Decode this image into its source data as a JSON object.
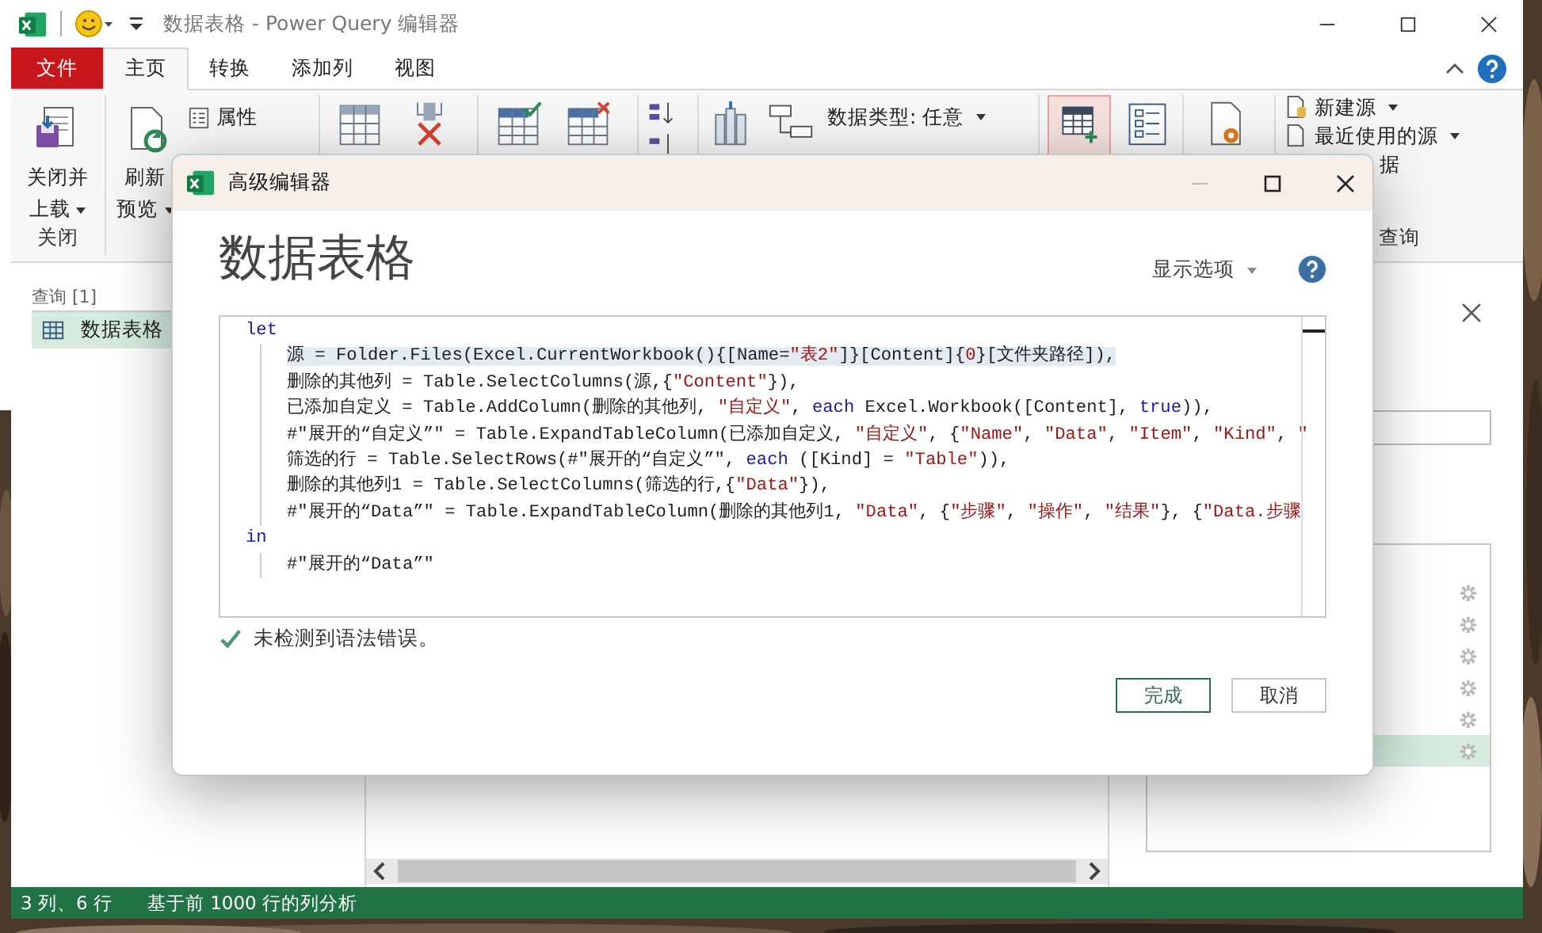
{
  "window": {
    "title": "数据表格 - Power Query 编辑器"
  },
  "ribbon_tabs": [
    {
      "label": "文件",
      "kind": "file",
      "selected": false
    },
    {
      "label": "主页",
      "kind": "tab",
      "selected": true
    },
    {
      "label": "转换",
      "kind": "tab",
      "selected": false
    },
    {
      "label": "添加列",
      "kind": "tab",
      "selected": false
    },
    {
      "label": "视图",
      "kind": "tab",
      "selected": false
    }
  ],
  "ribbon": {
    "close_button": [
      "关闭并",
      "上载"
    ],
    "close_group_label": "关闭",
    "refresh_button": [
      "刷新",
      "预览"
    ],
    "properties": "属性",
    "data_type": "数据类型: 任意",
    "new_source": "新建源",
    "recent_sources": "最近使用的源",
    "partial_text": "据",
    "query_group_label": "查询"
  },
  "queries_pane": {
    "header": "查询 [1]",
    "items": [
      {
        "label": "数据表格",
        "selected": true
      }
    ]
  },
  "query_settings": {
    "steps": [
      {
        "selected": false
      },
      {
        "selected": false
      },
      {
        "selected": false
      },
      {
        "selected": false
      },
      {
        "selected": false
      },
      {
        "selected": true
      }
    ]
  },
  "status_bar": {
    "columns_rows": "3 列、6 行",
    "profiling": "基于前 1000 行的列分析"
  },
  "dialog": {
    "title": "高级编辑器",
    "query_name": "数据表格",
    "display_options": "显示选项",
    "code": [
      {
        "highlighted": false,
        "tokens": [
          {
            "kind": "keyword",
            "text": "let"
          }
        ],
        "children": [
          {
            "highlighted": true,
            "tokens": [
              {
                "kind": "plain",
                "text": "源 = Folder.Files(Excel.CurrentWorkbook(){[Name="
              },
              {
                "kind": "string",
                "text": "\"表2\""
              },
              {
                "kind": "plain",
                "text": "]}[Content]{"
              },
              {
                "kind": "number",
                "text": "0"
              },
              {
                "kind": "plain",
                "text": "}[文件夹路径]),"
              }
            ]
          },
          {
            "highlighted": false,
            "tokens": [
              {
                "kind": "plain",
                "text": "删除的其他列 = Table.SelectColumns(源,{"
              },
              {
                "kind": "string",
                "text": "\"Content\""
              },
              {
                "kind": "plain",
                "text": "}),"
              }
            ]
          },
          {
            "highlighted": false,
            "tokens": [
              {
                "kind": "plain",
                "text": "已添加自定义 = Table.AddColumn(删除的其他列, "
              },
              {
                "kind": "string",
                "text": "\"自定义\""
              },
              {
                "kind": "plain",
                "text": ", "
              },
              {
                "kind": "keyword",
                "text": "each"
              },
              {
                "kind": "plain",
                "text": " Excel.Workbook([Content], "
              },
              {
                "kind": "keyword",
                "text": "true"
              },
              {
                "kind": "plain",
                "text": ")),"
              }
            ]
          },
          {
            "highlighted": false,
            "tokens": [
              {
                "kind": "plain",
                "text": "#\"展开的“自定义”\" = Table.ExpandTableColumn(已添加自定义, "
              },
              {
                "kind": "string",
                "text": "\"自定义\""
              },
              {
                "kind": "plain",
                "text": ", {"
              },
              {
                "kind": "string",
                "text": "\"Name\""
              },
              {
                "kind": "plain",
                "text": ", "
              },
              {
                "kind": "string",
                "text": "\"Data\""
              },
              {
                "kind": "plain",
                "text": ", "
              },
              {
                "kind": "string",
                "text": "\"Item\""
              },
              {
                "kind": "plain",
                "text": ", "
              },
              {
                "kind": "string",
                "text": "\"Kind\""
              },
              {
                "kind": "plain",
                "text": ", "
              },
              {
                "kind": "string",
                "text": "\""
              }
            ]
          },
          {
            "highlighted": false,
            "tokens": [
              {
                "kind": "plain",
                "text": "筛选的行 = Table.SelectRows(#\"展开的“自定义”\", "
              },
              {
                "kind": "keyword",
                "text": "each"
              },
              {
                "kind": "plain",
                "text": " ([Kind] = "
              },
              {
                "kind": "string",
                "text": "\"Table\""
              },
              {
                "kind": "plain",
                "text": ")),"
              }
            ]
          },
          {
            "highlighted": false,
            "tokens": [
              {
                "kind": "plain",
                "text": "删除的其他列1 = Table.SelectColumns(筛选的行,{"
              },
              {
                "kind": "string",
                "text": "\"Data\""
              },
              {
                "kind": "plain",
                "text": "}),"
              }
            ]
          },
          {
            "highlighted": false,
            "tokens": [
              {
                "kind": "plain",
                "text": "#\"展开的“Data”\" = Table.ExpandTableColumn(删除的其他列1, "
              },
              {
                "kind": "string",
                "text": "\"Data\""
              },
              {
                "kind": "plain",
                "text": ", {"
              },
              {
                "kind": "string",
                "text": "\"步骤\""
              },
              {
                "kind": "plain",
                "text": ", "
              },
              {
                "kind": "string",
                "text": "\"操作\""
              },
              {
                "kind": "plain",
                "text": ", "
              },
              {
                "kind": "string",
                "text": "\"结果\""
              },
              {
                "kind": "plain",
                "text": "}, {"
              },
              {
                "kind": "string",
                "text": "\"Data.步骤"
              }
            ]
          }
        ]
      },
      {
        "highlighted": false,
        "tokens": [
          {
            "kind": "keyword",
            "text": "in"
          }
        ],
        "children": [
          {
            "highlighted": false,
            "tokens": [
              {
                "kind": "plain",
                "text": "#\"展开的“Data”\""
              }
            ]
          }
        ]
      }
    ],
    "status": "未检测到语法错误。",
    "buttons": [
      {
        "label": "完成",
        "kind": "primary"
      },
      {
        "label": "取消",
        "kind": "secondary"
      }
    ]
  }
}
